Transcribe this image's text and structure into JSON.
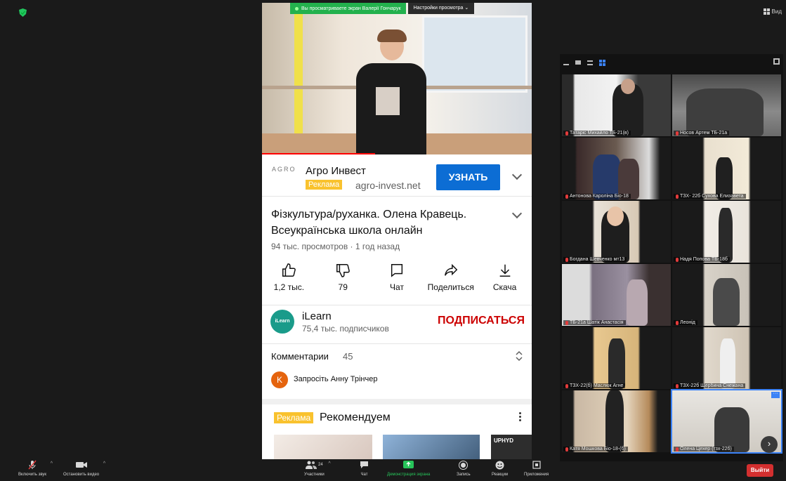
{
  "topbar": {
    "view_label": "Вид"
  },
  "share": {
    "banner_text": "Вы просматриваете экран Валерії Гончарук",
    "options_label": "Настройки просмотра ⌄"
  },
  "youtube": {
    "ad": {
      "logo_text": "AGRO",
      "title": "Агро Инвест",
      "badge": "Реклама",
      "url": "agro-invest.net",
      "cta": "УЗНАТЬ"
    },
    "video": {
      "title": "Фізкультура/руханка. Олена Кравець. Всеукраїнська школа онлайн",
      "meta": "94 тыс. просмотров · 1 год назад",
      "progress": 0.42
    },
    "actions": [
      {
        "label": "1,2 тыс.",
        "icon": "like-icon"
      },
      {
        "label": "79",
        "icon": "dislike-icon"
      },
      {
        "label": "Чат",
        "icon": "chat-icon"
      },
      {
        "label": "Поделиться",
        "icon": "share-icon"
      },
      {
        "label": "Скача",
        "icon": "download-icon"
      }
    ],
    "channel": {
      "avatar_text": "iLearn",
      "name": "iLearn",
      "subscribers": "75,4 тыс. подписчиков",
      "subscribe": "ПОДПИСАТЬСЯ"
    },
    "comments": {
      "label": "Комментарии",
      "count": "45",
      "avatar_letter": "K",
      "invite": "Запросіть Анну Трінчер"
    },
    "recommend": {
      "badge": "Реклама",
      "title": "Рекомендуем",
      "thumb_text": "UPHYD"
    }
  },
  "gallery": {
    "participants": [
      {
        "name": "Татаріс Михайло ТБ-21(в)"
      },
      {
        "name": "Носов Артем ТБ-21а"
      },
      {
        "name": "Антонова Кароліна Біо-18"
      },
      {
        "name": "ТЗХ- 22б Сухова Елизавета"
      },
      {
        "name": "Богдана Шевченко мт13"
      },
      {
        "name": "Надя Попова ТБ-18б"
      },
      {
        "name": "ТБ-21а Шатік Анастасія"
      },
      {
        "name": "Леонід"
      },
      {
        "name": "ТЗХ-22(б) Маслюк Агне"
      },
      {
        "name": "ТЗХ-22б Щербина Снежана"
      },
      {
        "name": "Катя Мошкова Біо-18-(б)"
      },
      {
        "name": "Олена Цехер (тзх-22б)"
      }
    ],
    "next_label": "›",
    "more_label": "···"
  },
  "toolbar": {
    "mute": "Включить звук",
    "video": "Остановить видео",
    "participants": "Участники",
    "participants_count": "24",
    "chat": "Чат",
    "share": "Демонстрация экрана",
    "record": "Запись",
    "reactions": "Реакции",
    "apps": "Приложения",
    "leave": "Выйти"
  }
}
